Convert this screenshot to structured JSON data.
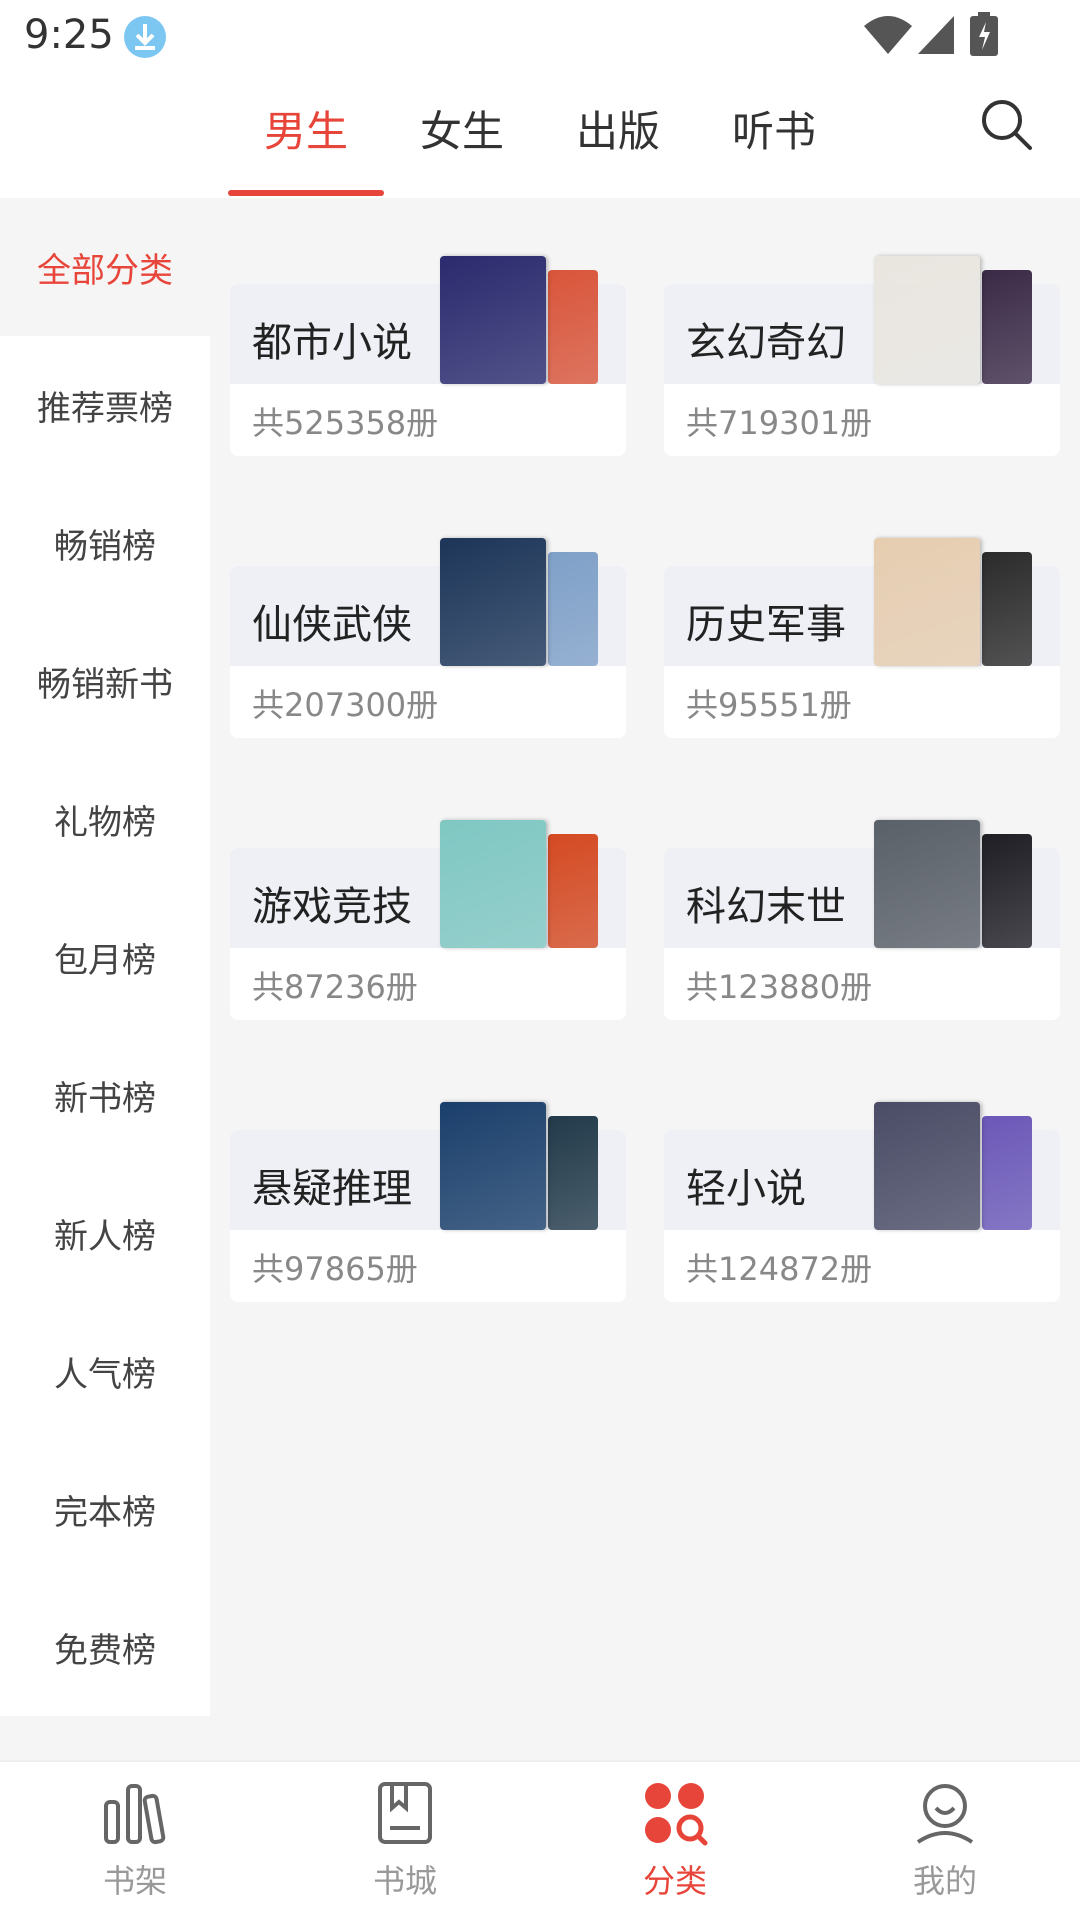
{
  "status_bar": {
    "time": "9:25"
  },
  "top_tabs": [
    "男生",
    "女生",
    "出版",
    "听书"
  ],
  "sidebar": {
    "items": [
      "全部分类",
      "推荐票榜",
      "畅销榜",
      "畅销新书",
      "礼物榜",
      "包月榜",
      "新书榜",
      "新人榜",
      "人气榜",
      "完本榜",
      "免费榜"
    ]
  },
  "categories": [
    {
      "name": "都市小说",
      "count": "共525358册",
      "cover_colors": [
        "#2a2a6e",
        "#d9553a"
      ]
    },
    {
      "name": "玄幻奇幻",
      "count": "共719301册",
      "cover_colors": [
        "#e9e6e0",
        "#3b2a47"
      ]
    },
    {
      "name": "仙侠武侠",
      "count": "共207300册",
      "cover_colors": [
        "#1c3558",
        "#7fa0c8"
      ]
    },
    {
      "name": "历史军事",
      "count": "共95551册",
      "cover_colors": [
        "#e6cdb0",
        "#2b2b2b"
      ]
    },
    {
      "name": "游戏竞技",
      "count": "共87236册",
      "cover_colors": [
        "#7fc7c2",
        "#d44a22"
      ]
    },
    {
      "name": "科幻末世",
      "count": "共123880册",
      "cover_colors": [
        "#5a6068",
        "#1e1e24"
      ]
    },
    {
      "name": "悬疑推理",
      "count": "共97865册",
      "cover_colors": [
        "#1a3f6b",
        "#223a4a"
      ]
    },
    {
      "name": "轻小说",
      "count": "共124872册",
      "cover_colors": [
        "#4a4c66",
        "#6b58b8"
      ]
    }
  ],
  "bottom_nav": [
    "书架",
    "书城",
    "分类",
    "我的"
  ],
  "colors": {
    "accent": "#e8453a",
    "background": "#f5f5f5"
  }
}
